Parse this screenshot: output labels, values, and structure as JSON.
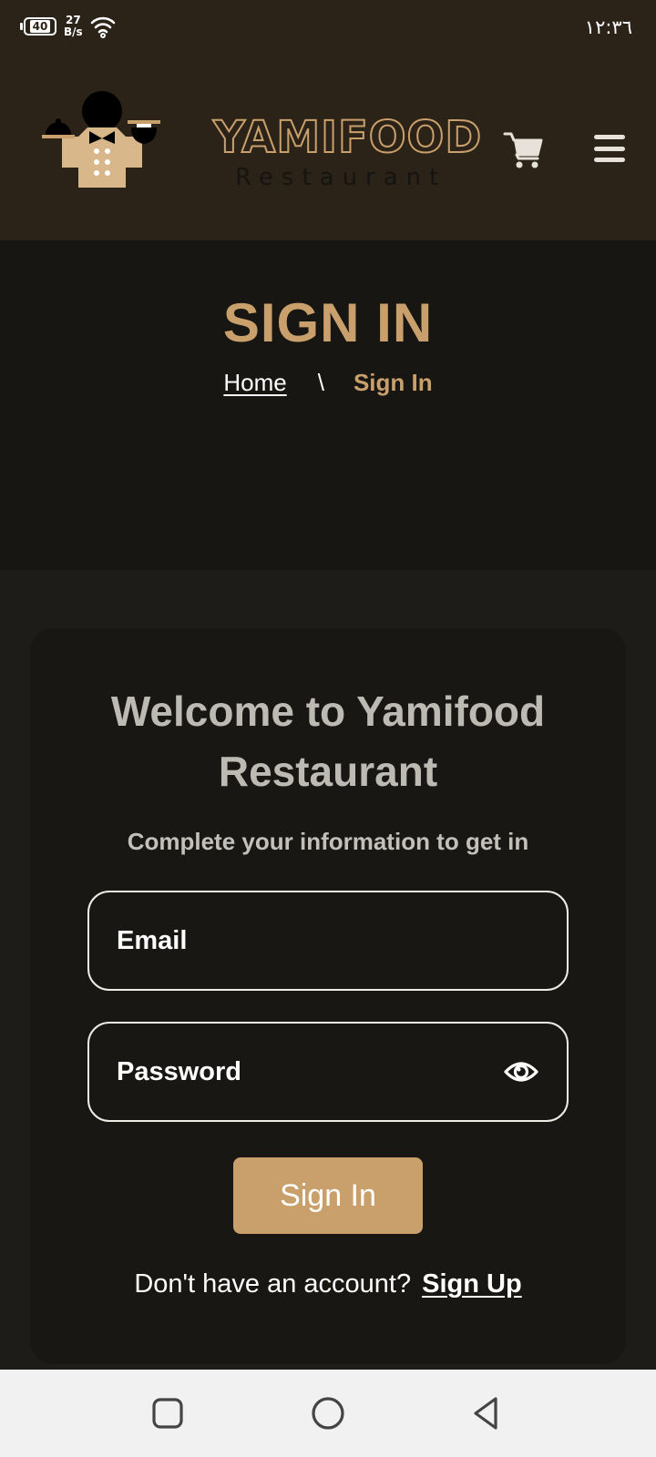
{
  "status_bar": {
    "battery": "40",
    "net_speed_value": "27",
    "net_speed_unit": "B/s",
    "time": "١٢:٣٦"
  },
  "header": {
    "logo_title": "YAMIFOOD",
    "logo_subtitle": "Restaurant",
    "cart_icon": "shopping-cart-icon",
    "menu_icon": "hamburger-menu-icon"
  },
  "hero": {
    "title": "SIGN IN",
    "breadcrumb": {
      "home": "Home",
      "separator": "\\",
      "current": "Sign In"
    }
  },
  "form": {
    "welcome": "Welcome to Yamifood Restaurant",
    "subtitle": "Complete your information to get in",
    "email_label": "Email",
    "password_label": "Password",
    "password_toggle_icon": "eye-icon",
    "submit_label": "Sign In",
    "signup_prompt": "Don't have an account?",
    "signup_link": "Sign Up"
  },
  "colors": {
    "accent": "#c9a06c",
    "header_bg": "#2b2218",
    "hero_bg": "#171612",
    "page_bg": "#1d1c18",
    "card_bg": "#181713",
    "nav_bg": "#f1f1f1"
  },
  "nav_bar": {
    "icons": [
      "recents-square-icon",
      "home-circle-icon",
      "back-triangle-icon"
    ]
  }
}
